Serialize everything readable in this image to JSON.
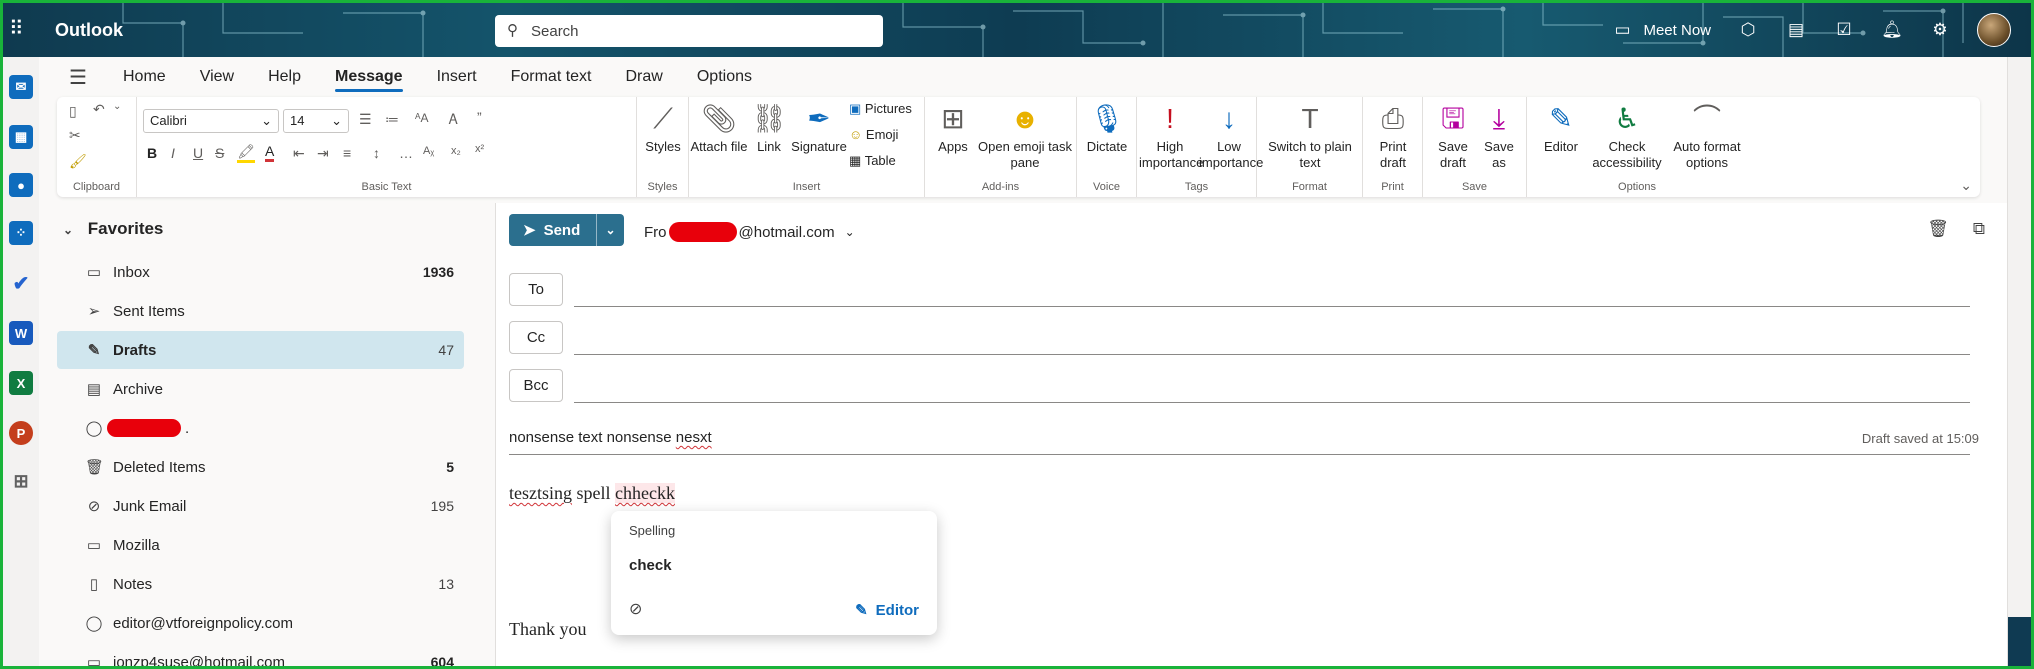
{
  "header": {
    "app_title": "Outlook",
    "search_placeholder": "Search",
    "meet_now": "Meet Now"
  },
  "rail": {
    "apps": [
      {
        "name": "mail-app",
        "color": "#0f6cbd",
        "glyph": "✉"
      },
      {
        "name": "calendar-app",
        "color": "#0f6cbd",
        "glyph": "▦"
      },
      {
        "name": "people-app",
        "color": "#0f6cbd",
        "glyph": "👥"
      },
      {
        "name": "groups-app",
        "color": "#0f6cbd",
        "glyph": "⁘"
      },
      {
        "name": "todo-app",
        "color": "#2564cf",
        "glyph": "✔"
      },
      {
        "name": "word-app",
        "color": "#185abd",
        "glyph": "W"
      },
      {
        "name": "excel-app",
        "color": "#107c41",
        "glyph": "X"
      },
      {
        "name": "powerpoint-app",
        "color": "#c43e1c",
        "glyph": "P"
      },
      {
        "name": "more-apps",
        "color": "#616161",
        "glyph": "▣"
      }
    ]
  },
  "ribbon": {
    "tabs": [
      "Home",
      "View",
      "Help",
      "Message",
      "Insert",
      "Format text",
      "Draw",
      "Options"
    ],
    "active_tab": "Message",
    "font_name": "Calibri",
    "font_size": "14",
    "groups": {
      "clipboard": "Clipboard",
      "basic_text": "Basic Text",
      "styles": "Styles",
      "insert": "Insert",
      "addins": "Add-ins",
      "voice": "Voice",
      "tags": "Tags",
      "format": "Format",
      "print": "Print",
      "save": "Save",
      "options": "Options"
    },
    "buttons": {
      "styles": "Styles",
      "attach_file": "Attach file",
      "link": "Link",
      "signature": "Signature",
      "pictures": "Pictures",
      "emoji": "Emoji",
      "table": "Table",
      "apps": "Apps",
      "open_emoji": "Open emoji task pane",
      "dictate": "Dictate",
      "high_importance": "High importance",
      "low_importance": "Low importance",
      "switch_plain": "Switch to plain text",
      "print_draft": "Print draft",
      "save_draft": "Save draft",
      "save_as": "Save as",
      "editor": "Editor",
      "check_accessibility": "Check accessibility",
      "auto_format": "Auto format options"
    },
    "colors": {
      "highlight": "#ffd700",
      "font_color": "#d13438",
      "accent": "#0f6cbd"
    }
  },
  "folders": {
    "section": "Favorites",
    "items": [
      {
        "label": "Inbox",
        "count": "1936",
        "icon": "inbox-icon"
      },
      {
        "label": "Sent Items",
        "count": "",
        "icon": "send-icon"
      },
      {
        "label": "Drafts",
        "count": "47",
        "icon": "pencil-icon"
      },
      {
        "label": "Archive",
        "count": "",
        "icon": "archive-icon"
      },
      {
        "label": ".",
        "count": "",
        "icon": "person-icon"
      },
      {
        "label": "Deleted Items",
        "count": "5",
        "icon": "trash-icon"
      },
      {
        "label": "Junk Email",
        "count": "195",
        "icon": "junk-icon"
      },
      {
        "label": "Mozilla",
        "count": "",
        "icon": "folder-icon"
      },
      {
        "label": "Notes",
        "count": "13",
        "icon": "note-icon"
      },
      {
        "label": "editor@vtforeignpolicy.com",
        "count": "",
        "icon": "person-icon"
      },
      {
        "label": "jonzp4suse@hotmail.com",
        "count": "604",
        "icon": "folder-icon"
      }
    ]
  },
  "compose": {
    "send_label": "Send",
    "from_prefix": "Fro",
    "from_suffix": "@hotmail.com",
    "to_label": "To",
    "cc_label": "Cc",
    "bcc_label": "Bcc",
    "subject_part1": "nonsense text nonsense ",
    "subject_part2": "nesxt",
    "draft_saved": "Draft saved at 15:09",
    "body_word1": "tesztsing",
    "body_word2": " spell ",
    "body_word3": "chheckk",
    "thanks": "Thank you"
  },
  "spelling_popup": {
    "title": "Spelling",
    "suggestion": "check",
    "editor_label": "Editor"
  }
}
